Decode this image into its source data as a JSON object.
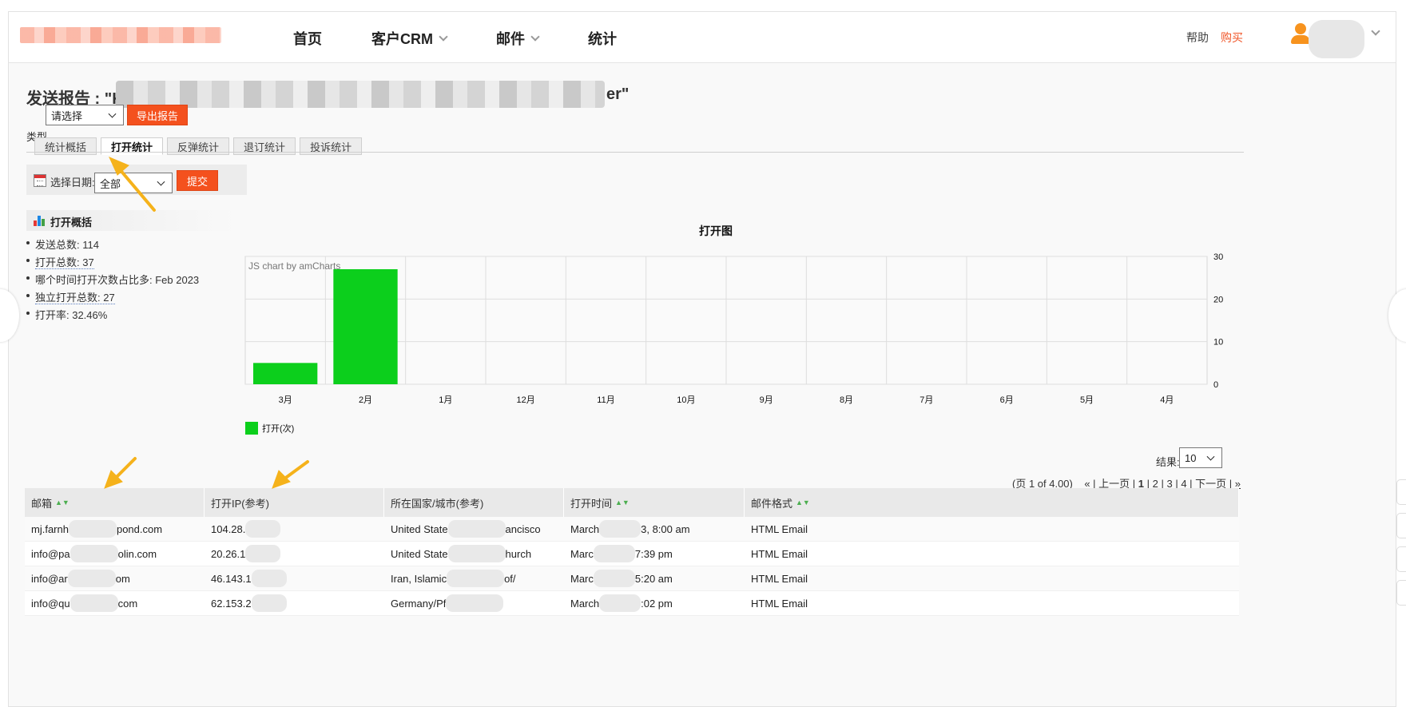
{
  "nav": {
    "home": "首页",
    "crm": "客户CRM",
    "mail": "邮件",
    "stats": "统计"
  },
  "header": {
    "help": "帮助",
    "buy": "购买"
  },
  "report": {
    "title_prefix": "发送报告 : \"K",
    "title_suffix": "er\""
  },
  "type_filter": {
    "label": "类型",
    "value": "请选择",
    "export_button": "导出报告"
  },
  "tabs": [
    {
      "label": "统计概括",
      "active": false
    },
    {
      "label": "打开统计",
      "active": true
    },
    {
      "label": "反弹统计",
      "active": false
    },
    {
      "label": "退订统计",
      "active": false
    },
    {
      "label": "投诉统计",
      "active": false
    }
  ],
  "date_filter": {
    "label": "选择日期:",
    "value": "全部",
    "submit": "提交"
  },
  "summary": {
    "title": "打开概括",
    "items": [
      {
        "text": "发送总数: 114"
      },
      {
        "text": "打开总数: 37"
      },
      {
        "text": "哪个时间打开次数占比多: Feb 2023"
      },
      {
        "text": "独立打开总数: 27"
      },
      {
        "text": "打开率: 32.46%"
      }
    ]
  },
  "chart_data": {
    "type": "bar",
    "title": "打开图",
    "watermark": "JS chart by amCharts",
    "categories": [
      "3月",
      "2月",
      "1月",
      "12月",
      "11月",
      "10月",
      "9月",
      "8月",
      "7月",
      "6月",
      "5月",
      "4月"
    ],
    "series": [
      {
        "name": "打开(次)",
        "color": "#0ccf1c",
        "values": [
          5,
          27,
          0,
          0,
          0,
          0,
          0,
          0,
          0,
          0,
          0,
          0
        ]
      }
    ],
    "ylim": [
      0,
      30
    ],
    "yticks": [
      0,
      10,
      20,
      30
    ],
    "y_axis_side": "right",
    "grid": true,
    "legend": "bottom-left"
  },
  "results": {
    "label": "结果:",
    "value": "10"
  },
  "pager": {
    "info": "(页 1 of 4.00)",
    "first": "«",
    "prev": "上一页",
    "pages": [
      "1",
      "2",
      "3",
      "4"
    ],
    "current": "1",
    "next": "下一页",
    "last": "»"
  },
  "table": {
    "columns": [
      "邮箱",
      "打开IP(参考)",
      "所在国家/城市(参考)",
      "打开时间",
      "邮件格式"
    ],
    "rows": [
      {
        "email": "mj.farnh",
        "email_tail": "pond.com",
        "ip": "104.28.",
        "loc": "United State",
        "loc_tail": "ancisco",
        "time": "March",
        "time_tail": "3, 8:00 am",
        "format": "HTML Email"
      },
      {
        "email": "info@pa",
        "email_tail": "olin.com",
        "ip": "20.26.1",
        "loc": "United State",
        "loc_tail": "hurch",
        "time": "Marc",
        "time_tail": "7:39 pm",
        "format": "HTML Email"
      },
      {
        "email": "info@ar",
        "email_tail": "om",
        "ip": "46.143.1",
        "loc": "Iran, Islamic",
        "loc_tail": "of/",
        "time": "Marc",
        "time_tail": "5:20 am",
        "format": "HTML Email"
      },
      {
        "email": "info@qu",
        "email_tail": "com",
        "ip": "62.153.2",
        "loc": "Germany/Pf",
        "loc_tail": "",
        "time": "March",
        "time_tail": ":02 pm",
        "format": "HTML Email"
      }
    ]
  }
}
